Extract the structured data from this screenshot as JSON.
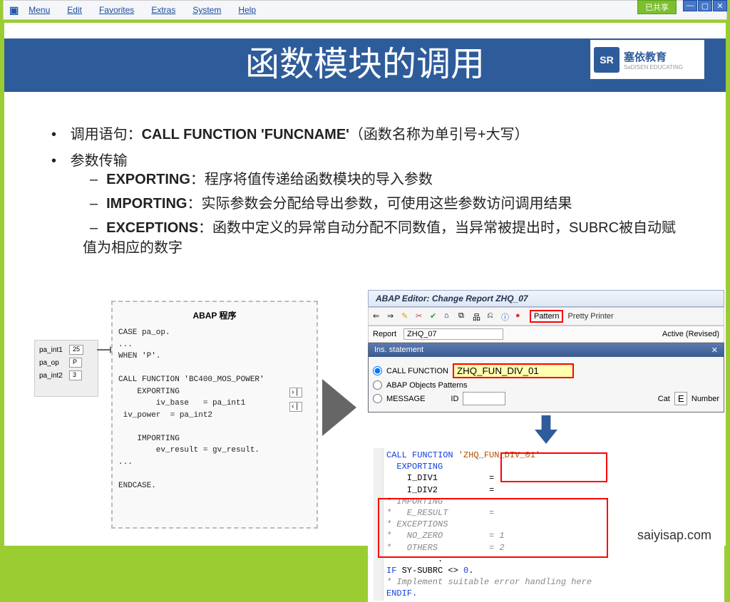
{
  "menu": {
    "items": [
      "Menu",
      "Edit",
      "Favorites",
      "Extras",
      "System",
      "Help"
    ]
  },
  "shareTag": "已共享",
  "logo": {
    "cn": "塞依教育",
    "en": "SaDISEN EDUCATING",
    "mark": "SR"
  },
  "title": "函数模块的调用",
  "bullets": {
    "b1_prefix": "调用语句：",
    "b1_bold": "CALL FUNCTION 'FUNCNAME'",
    "b1_suffix": "（函数名称为单引号+大写）",
    "b2": "参数传输",
    "sub": [
      {
        "k": "EXPORTING",
        "t": "：程序将值传递给函数模块的导入参数"
      },
      {
        "k": "IMPORTING",
        "t": "：实际参数会分配给导出参数，可使用这些参数访问调用结果"
      },
      {
        "k": "EXCEPTIONS",
        "t": "：函数中定义的异常自动分配不同数值，当异常被提出时，SUBRC被自动赋值为相应的数字"
      }
    ]
  },
  "diagram": {
    "header": "ABAP 程序",
    "inputs": [
      {
        "label": "pa_int1",
        "value": "25"
      },
      {
        "label": "pa_op",
        "value": "P"
      },
      {
        "label": "pa_int2",
        "value": "3"
      }
    ],
    "code": "CASE pa_op.\n...\nWHEN 'P'.\n\nCALL FUNCTION 'BC400_MOS_POWER'\n    EXPORTING\n        iv_base   = pa_int1\n iv_power  = pa_int2\n\n    IMPORTING\n        ev_result = gv_result.\n...\n\nENDCASE."
  },
  "sap": {
    "title": "ABAP Editor: Change Report ZHQ_07",
    "pattern": "Pattern",
    "pretty": "Pretty Printer",
    "reportLbl": "Report",
    "reportVal": "ZHQ_07",
    "status": "Active (Revised)",
    "dlg": {
      "title": "Ins. statement",
      "opt1": "CALL FUNCTION",
      "opt1val": "ZHQ_FUN_DIV_01",
      "opt2": "ABAP Objects Patterns",
      "opt3": "MESSAGE",
      "idLbl": "ID",
      "catLbl": "Cat",
      "catVal": "E",
      "numLbl": "Number"
    },
    "codeLines": [
      {
        "t": "CALL FUNCTION ",
        "lit": "'ZHQ_FUN_DIV_01'"
      },
      {
        "t": "  EXPORTING"
      },
      {
        "t": "    I_DIV1          ="
      },
      {
        "t": "    I_DIV2          ="
      },
      {
        "cm": "* IMPORTING"
      },
      {
        "cm": "*   E_RESULT        ="
      },
      {
        "cm": "* EXCEPTIONS"
      },
      {
        "cm": "*   NO_ZERO         = 1"
      },
      {
        "cm": "*   OTHERS          = 2"
      },
      {
        "t": "          ."
      },
      {
        "if1": "IF ",
        "if2": "SY-SUBRC ",
        "op": "<> ",
        "n": "0",
        "dot": "."
      },
      {
        "cm": "* Implement suitable error handling here"
      },
      {
        "t": "ENDIF."
      }
    ]
  },
  "footer": "saiyisap.com"
}
